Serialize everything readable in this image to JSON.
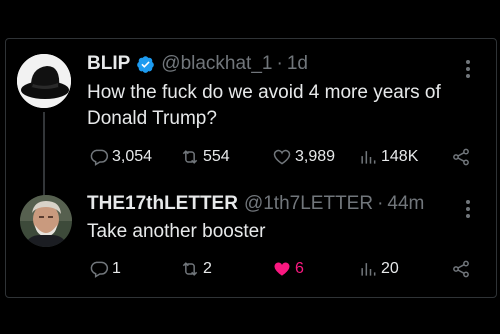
{
  "tweets": [
    {
      "name": "BLIP",
      "handle": "@blackhat_1",
      "separator": "·",
      "time": "1d",
      "text": "How the fuck do we avoid 4 more years of Donald Trump?",
      "replies": "3,054",
      "retweets": "554",
      "likes": "3,989",
      "views": "148K",
      "verified": true,
      "icons": [
        "reply-icon",
        "retweet-icon",
        "like-icon",
        "views-icon",
        "share-icon"
      ]
    },
    {
      "name": "THE17thLETTER",
      "handle": "@1th7LETTER",
      "separator": "·",
      "time": "44m",
      "text": "Take another booster",
      "replies": "1",
      "retweets": "2",
      "likes": "6",
      "views": "20",
      "liked": true,
      "like_color": "#f91880",
      "icons": [
        "reply-icon",
        "retweet-icon",
        "like-icon",
        "views-icon",
        "share-icon"
      ]
    }
  ],
  "colors": {
    "verified": "#1d9bf0",
    "muted": "#71767b",
    "text": "#e7e9ea",
    "like": "#f91880"
  }
}
